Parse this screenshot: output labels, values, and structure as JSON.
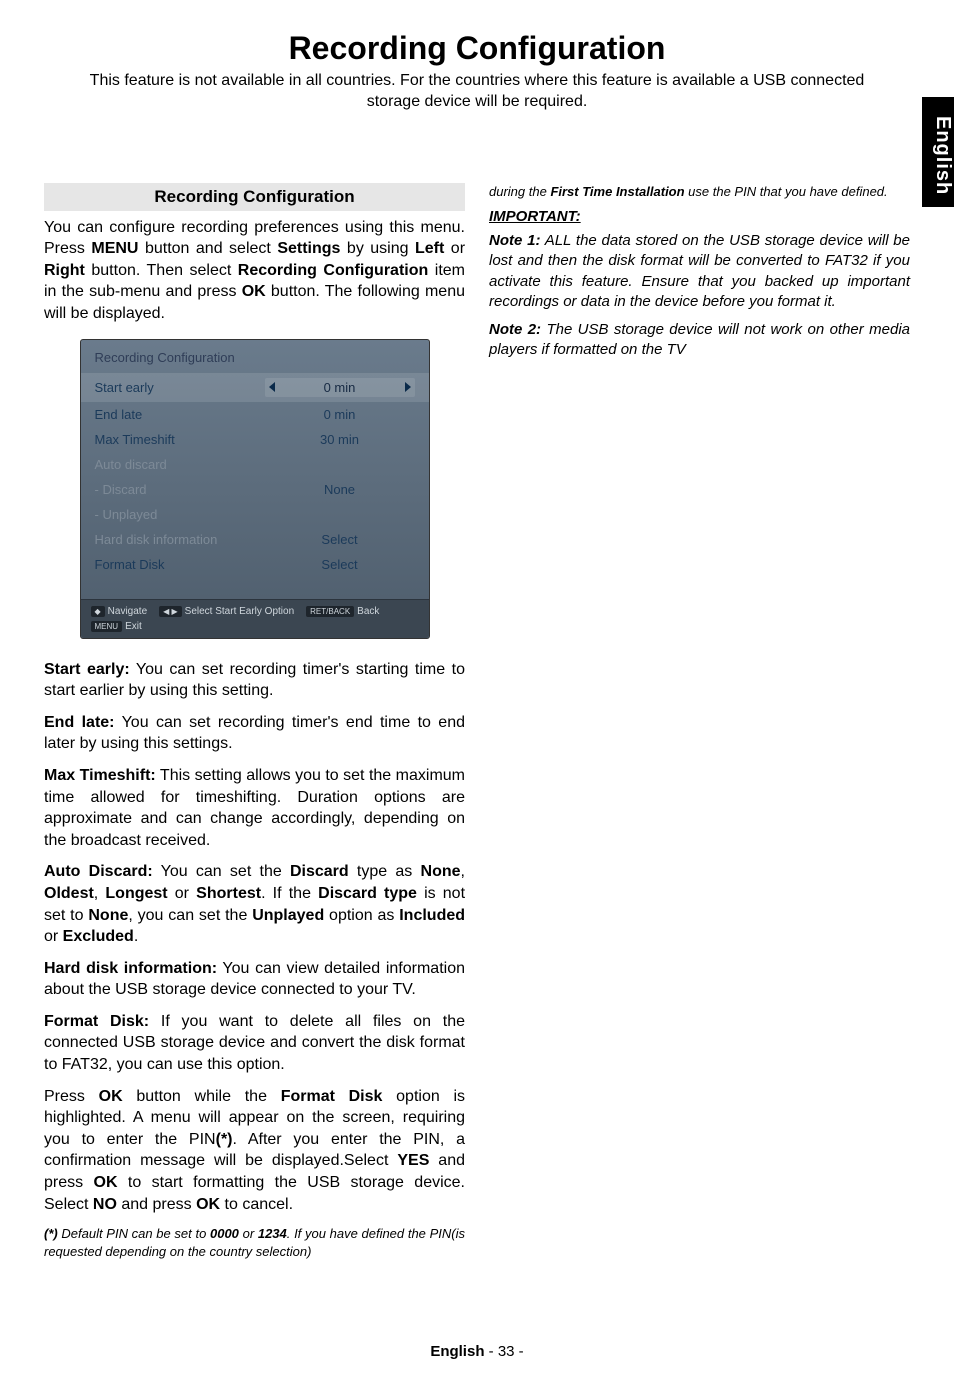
{
  "side_tab": "English",
  "title": "Recording Configuration",
  "subtitle": "This feature is not available in all countries. For the countries where this feature is available a USB connected storage device will be required.",
  "left": {
    "section_header": "Recording Configuration",
    "intro_parts": {
      "p1": "You can configure recording preferences using this menu. Press ",
      "b1": "MENU",
      "p2": " button and select ",
      "b2": "Settings",
      "p3": " by using ",
      "b3": "Left",
      "p4": " or ",
      "b4": "Right",
      "p5": " button. Then select ",
      "b5": "Recording Configuration",
      "p6": " item in the sub-menu and press ",
      "b6": "OK",
      "p7": " button. The following menu will be displayed."
    },
    "panel": {
      "title": "Recording Configuration",
      "rows": [
        {
          "label": "Start early",
          "value": "0 min",
          "highlight": true
        },
        {
          "label": "End late",
          "value": "0 min"
        },
        {
          "label": "Max Timeshift",
          "value": "30 min"
        },
        {
          "label": "Auto discard",
          "value": "",
          "dim": true
        },
        {
          "label": "- Discard",
          "value": "None",
          "dim": true
        },
        {
          "label": "- Unplayed",
          "value": "",
          "dim": true
        },
        {
          "label": "Hard disk information",
          "value": "Select",
          "dim": true
        },
        {
          "label": "Format Disk",
          "value": "Select"
        }
      ],
      "footer": {
        "nav_key": "◆",
        "nav": "Navigate",
        "sel_key": "◀ ▶",
        "sel": "Select Start Early Option",
        "back_key": "RET/BACK",
        "back": "Back",
        "menu_key": "MENU",
        "exit": "Exit"
      }
    },
    "start_early_b": "Start early:",
    "start_early_t": " You can set recording timer's starting time to start earlier by using this setting.",
    "end_late_b": "End late:",
    "end_late_t": " You can set recording timer's end time to end later by using this settings.",
    "max_ts_b": "Max Timeshift:",
    "max_ts_t": " This setting allows you to set the maximum time allowed for timeshifting. Duration options are approximate and can change accordingly, depending on the broadcast received.",
    "auto_discard_b": "Auto Discard:",
    "auto_discard_t1": " You can set the ",
    "auto_discard_b2": "Discard",
    "auto_discard_t2": " type as ",
    "auto_discard_b3": "None",
    "auto_discard_t3": ", ",
    "auto_discard_b4": "Oldest",
    "auto_discard_t4": ", ",
    "auto_discard_b5": "Longest",
    "auto_discard_t5": " or ",
    "auto_discard_b6": "Shortest",
    "auto_discard_t6": ". If the ",
    "auto_discard_b7": "Discard type",
    "auto_discard_t7": " is not set to ",
    "auto_discard_b8": "None",
    "auto_discard_t8": ", you can set the ",
    "auto_discard_b9": "Unplayed",
    "auto_discard_t9": " option as ",
    "auto_discard_b10": "Included",
    "auto_discard_t10": " or ",
    "auto_discard_b11": "Excluded",
    "auto_discard_t11": ".",
    "hdi_b": "Hard disk information:",
    "hdi_t": " You can view detailed information about the USB storage device connected to your TV.",
    "format_b": "Format Disk:",
    "format_t": " If you want to delete all files on the connected USB storage device and convert the disk format to FAT32, you can use this option.",
    "press_p1": "Press ",
    "press_b1": "OK",
    "press_p2": " button while the ",
    "press_b2": "Format Disk",
    "press_p3": " option is highlighted. A menu will appear on the screen, requiring you to enter the PIN",
    "press_b3": "(*)",
    "press_p4": ". After you enter the PIN, a confirmation message will be displayed.Select ",
    "press_b4": "YES",
    "press_p5": " and press ",
    "press_b5": "OK",
    "press_p6": " to start formatting the USB storage device. Select ",
    "press_b6": "NO",
    "press_p7": " and press ",
    "press_b7": "OK",
    "press_p8": " to cancel.",
    "note_b1": "(*)",
    "note_t1": " Default PIN can be set to ",
    "note_b2": "0000",
    "note_t2": " or ",
    "note_b3": "1234",
    "note_t3": ". If you have defined the PIN(is requested depending on the country selection) "
  },
  "right": {
    "cont_t1": "during the ",
    "cont_b1": "First Time Installation",
    "cont_t2": " use the PIN that you have defined.",
    "important": "IMPORTANT: ",
    "note1_b": "Note 1:",
    "note1_t": " ALL the data stored on the USB storage device will be lost and then the disk format will be converted to FAT32 if you activate this feature. Ensure that you backed up important recordings or data in the device before you format it.",
    "note2_b": "Note 2:",
    "note2_t": " The USB storage device will not work on other media players if formatted on the TV"
  },
  "footer": {
    "lang": "English",
    "page": "   - 33 -"
  }
}
